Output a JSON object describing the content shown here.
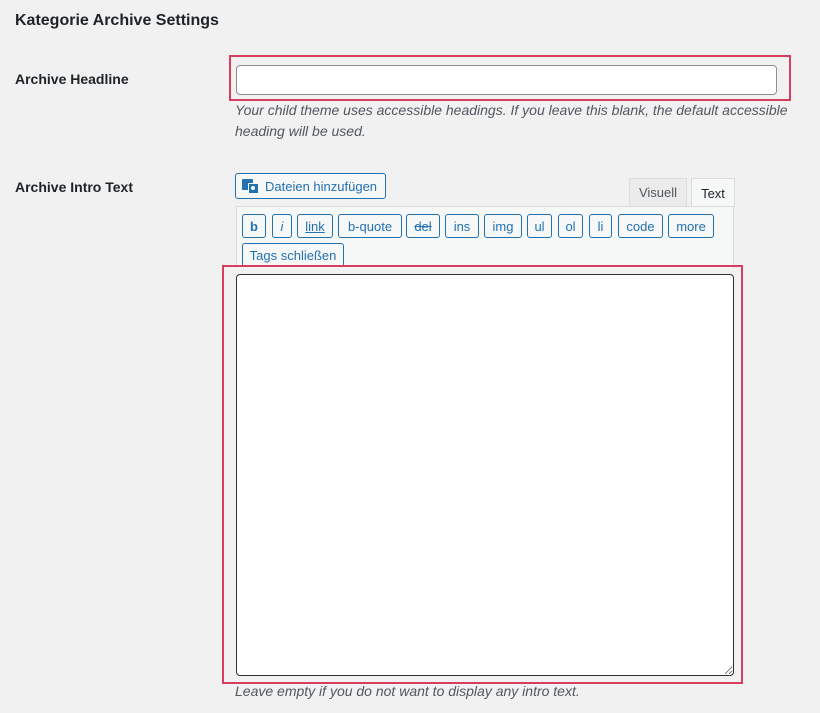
{
  "section": {
    "title": "Kategorie Archive Settings"
  },
  "headline": {
    "label": "Archive Headline",
    "value": "",
    "description": "Your child theme uses accessible headings. If you leave this blank, the default accessible heading will be used."
  },
  "intro": {
    "label": "Archive Intro Text",
    "media_button_label": "Dateien hinzufügen",
    "media_icon": "add-media-icon",
    "tabs": {
      "visual": "Visuell",
      "text": "Text",
      "active": "Text"
    },
    "quicktags": [
      "b",
      "i",
      "link",
      "b-quote",
      "del",
      "ins",
      "img",
      "ul",
      "ol",
      "li",
      "code",
      "more",
      "Tags schließen"
    ],
    "value": "",
    "description": "Leave empty if you do not want to display any intro text."
  },
  "colors": {
    "highlight_border": "#d63d5f",
    "button_blue": "#2271b1",
    "background": "#f1f1f1"
  }
}
